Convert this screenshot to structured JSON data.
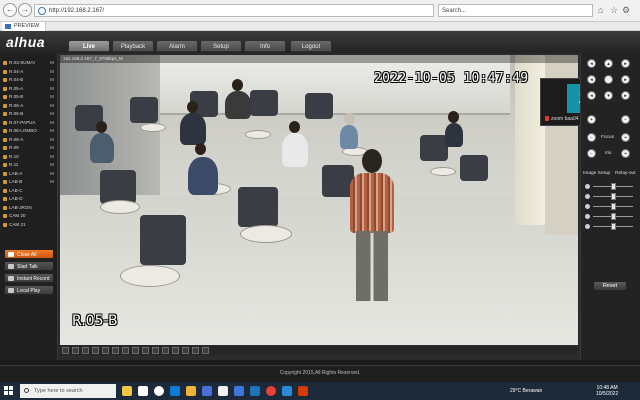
{
  "browser": {
    "address": "http://192.168.2.167/",
    "search_placeholder": "Search...",
    "tab_title": "PREVIEW"
  },
  "app": {
    "logo": "alhua",
    "tabs": [
      {
        "label": "Live",
        "active": true
      },
      {
        "label": "Playback",
        "active": false
      },
      {
        "label": "Alarm",
        "active": false
      },
      {
        "label": "Setup",
        "active": false
      },
      {
        "label": "Info",
        "active": false
      },
      {
        "label": "Logout",
        "active": false
      }
    ]
  },
  "channels": [
    {
      "label": "R.03-SUMAI",
      "mode": "M"
    },
    {
      "label": "R.04-A",
      "mode": "M"
    },
    {
      "label": "R.04-B",
      "mode": "M"
    },
    {
      "label": "R.05-A",
      "mode": "M"
    },
    {
      "label": "R.05-B",
      "mode": "M"
    },
    {
      "label": "R.06-A",
      "mode": "M"
    },
    {
      "label": "R.06-B",
      "mode": "M"
    },
    {
      "label": "R.07-PAPUA",
      "mode": "M"
    },
    {
      "label": "R.08-LOMBO",
      "mode": "M"
    },
    {
      "label": "R.08-A",
      "mode": "M"
    },
    {
      "label": "R.09",
      "mode": "M"
    },
    {
      "label": "R.10",
      "mode": "M"
    },
    {
      "label": "R.11",
      "mode": "M"
    },
    {
      "label": "LAB-A",
      "mode": "M"
    },
    {
      "label": "LAB-B",
      "mode": "M"
    },
    {
      "label": "LAB-C",
      "mode": ""
    },
    {
      "label": "LAB-D",
      "mode": ""
    },
    {
      "label": "LAB-JRGN",
      "mode": ""
    },
    {
      "label": "CAM 20",
      "mode": ""
    },
    {
      "label": "CAM 21",
      "mode": ""
    }
  ],
  "side_buttons": {
    "close_all": "Close All",
    "start_talk": "Start Talk",
    "instant_record": "Instant Record",
    "local_play": "Local Play"
  },
  "video": {
    "stream_info": "192.168.2.167_7_9796bps_M",
    "timestamp": "2022-10-05 10:47:49",
    "channel_name": "R.05-B"
  },
  "zoom": {
    "avatar_letter": "Z",
    "name": "zoom baa04"
  },
  "ptz": {
    "focus_label": "Focus",
    "iris_label": "Iris",
    "image_setup": "Image Setup",
    "relay_out": "Relay-out",
    "reset_label": "Reset",
    "sliders": [
      0.5,
      0.5,
      0.5,
      0.5,
      0.5
    ]
  },
  "footer": {
    "copyright": "Copyright 2015,All Rights Reserved."
  },
  "taskbar": {
    "search_placeholder": "Type here to search",
    "weather": "29°C  Berawan",
    "time": "10:48 AM",
    "date": "10/5/2022"
  },
  "colors": {
    "orange": "#e8661d",
    "header_dark": "#2a2a2a",
    "zoom_teal": "#1693a6"
  }
}
